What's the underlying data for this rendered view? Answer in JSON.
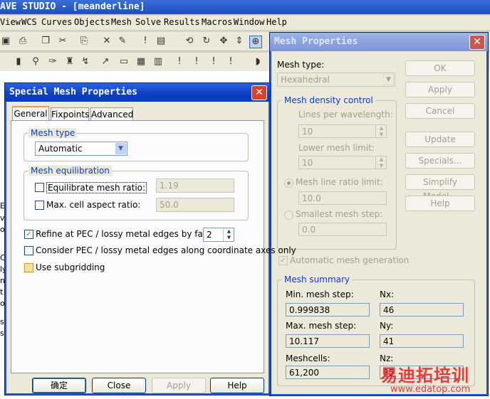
{
  "app": {
    "title": "AVE STUDIO - [meanderline]",
    "menu": [
      "View",
      "WCS",
      "Curves",
      "Objects",
      "Mesh",
      "Solve",
      "Results",
      "Macros",
      "Window",
      "Help"
    ]
  },
  "workspace": {
    "left_chars": [
      "El",
      "v",
      "of",
      "C",
      "ly",
      "nt",
      "t",
      "of",
      "st",
      "s"
    ]
  },
  "special_mesh": {
    "title": "Special Mesh Properties",
    "tabs": [
      "General",
      "Fixpoints",
      "Advanced"
    ],
    "mesh_type": {
      "group_label": "Mesh type",
      "value": "Automatic"
    },
    "equilibration": {
      "group_label": "Mesh equilibration",
      "equilibrate_label": "Equilibrate mesh ratio:",
      "equilibrate_value": "1.19",
      "max_cell_label": "Max. cell aspect ratio:",
      "max_cell_value": "50.0"
    },
    "refine_label": "Refine at PEC / lossy metal edges by factor:",
    "refine_value": "2",
    "consider_label": "Consider PEC / lossy metal edges along coordinate axes only",
    "subgridding_label": "Use subgridding",
    "buttons": {
      "ok": "确定",
      "close": "Close",
      "apply": "Apply",
      "help": "Help"
    }
  },
  "mesh_properties": {
    "title": "Mesh Properties",
    "mesh_type_label": "Mesh type:",
    "mesh_type_value": "Hexahedral",
    "density": {
      "group_label": "Mesh density control",
      "lines_label": "Lines per wavelength:",
      "lines_value": "10",
      "lower_label": "Lower mesh limit:",
      "lower_value": "10",
      "ratio_label": "Mesh line ratio limit:",
      "ratio_value": "10.0",
      "smallest_label": "Smallest mesh step:",
      "smallest_value": "0.0"
    },
    "auto_label": "Automatic mesh generation",
    "summary": {
      "group_label": "Mesh summary",
      "min_label": "Min. mesh step:",
      "min_value": "0.999838",
      "nx_label": "Nx:",
      "nx_value": "46",
      "max_label": "Max. mesh step:",
      "max_value": "10.117",
      "ny_label": "Ny:",
      "ny_value": "41",
      "cells_label": "Meshcells:",
      "cells_value": "61,200",
      "nz_label": "Nz:",
      "nz_value": "35"
    },
    "buttons": {
      "ok": "OK",
      "apply": "Apply",
      "cancel": "Cancel",
      "update": "Update",
      "specials": "Specials...",
      "simplify": "Simplify Model...",
      "help": "Help"
    }
  },
  "watermark": {
    "cn": "易迪拓培训",
    "url": "www.edatop.com"
  }
}
